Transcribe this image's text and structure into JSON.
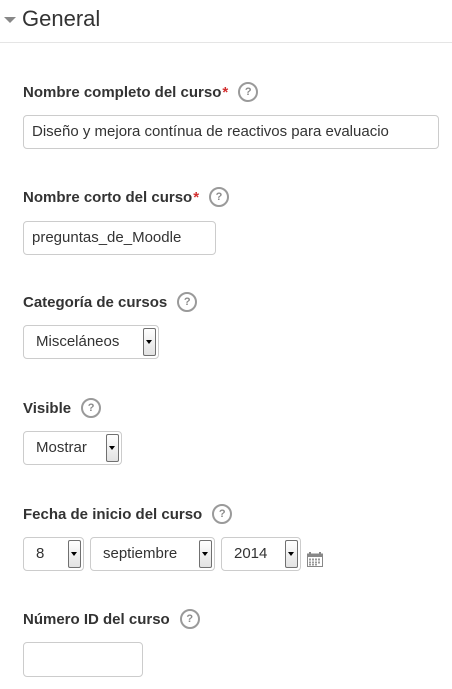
{
  "section": {
    "title": "General"
  },
  "fields": {
    "fullname": {
      "label": "Nombre completo del curso",
      "required_mark": "*",
      "value": "Diseño y mejora contínua de reactivos para evaluacio"
    },
    "shortname": {
      "label": "Nombre corto del curso",
      "required_mark": "*",
      "value": "preguntas_de_Moodle"
    },
    "category": {
      "label": "Categoría de cursos",
      "selected": "Misceláneos"
    },
    "visible": {
      "label": "Visible",
      "selected": "Mostrar"
    },
    "startdate": {
      "label": "Fecha de inicio del curso",
      "day": "8",
      "month": "septiembre",
      "year": "2014"
    },
    "idnumber": {
      "label": "Número ID del curso",
      "value": ""
    }
  },
  "icons": {
    "help": "?"
  },
  "colors": {
    "required": "#d32f2f",
    "help_icon": "#9a9a9a",
    "input_border": "#cccccc"
  }
}
